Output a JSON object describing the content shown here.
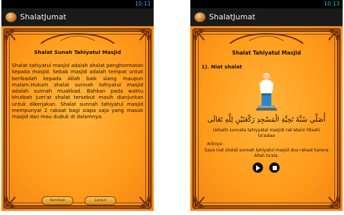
{
  "screens": [
    {
      "status_time": "10:11",
      "app_title": "ShalatJumat",
      "page_title": "Shalat Sunah Tahiyatul Masjid",
      "body": "Shalat tahiyatul masjid adalah shalat penghormatan kepada masjid. Sebab masjid adalah tempat untuk beribadah kepada Allah baik siang maupun malam.Hukum shalat sunnah tahiyatul masjid adalah sunnah muakkad. Bahkan pada waktu khutbah jum'at shalat tersebut masih dianjurkan untuk dikerjakan. Shalat sunnah tahiyatul masjid mempunyai 2 rakaat bagi siapa saja yang masuk masjid dan mau duduk di dalamnya.",
      "back_label": "Kembali",
      "next_label": "Lanjut"
    },
    {
      "status_time": "10:13",
      "app_title": "ShalatJumat",
      "page_title": "Shalat Tahiyatul Masjid",
      "step_title": "1). Niat shalat",
      "arabic_text": "أُصَلِّي سُنَّةَ تَحِيَّةِ الْمَسْجِدِ رَكْعَتَيْنِ لِلَّهِ تَعَالَى",
      "latin_text": "Ushallii sunnata tahiyyatal masjidi rak'ataini lillaahi ta'aalaa",
      "meaning_label": "Artinya :",
      "meaning_text": "Saya niat shalat sunnah tahiyatul masjid dua rakaat karena Allah ta'ala.",
      "icons": [
        "play-icon",
        "stop-icon"
      ]
    }
  ],
  "colors": {
    "background": "#ff9a1a",
    "frame": "#6b2f10",
    "status_time": "#33b5e5"
  }
}
